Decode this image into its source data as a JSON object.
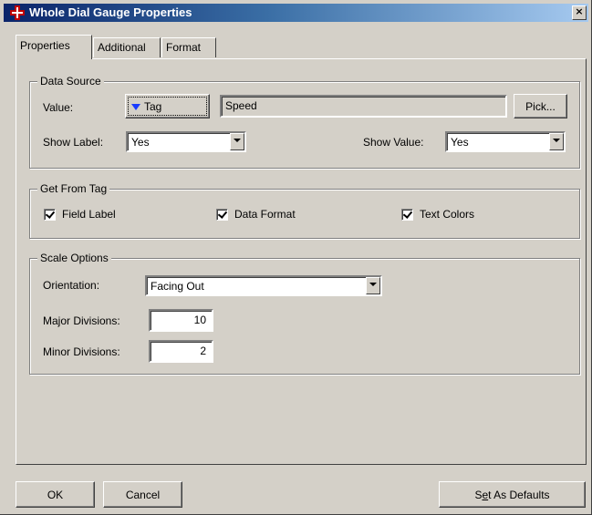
{
  "window": {
    "title": "Whole Dial Gauge Properties",
    "close_glyph": "×"
  },
  "tabs": [
    {
      "label": "Properties",
      "active": true
    },
    {
      "label": "Additional",
      "active": false
    },
    {
      "label": "Format",
      "active": false
    }
  ],
  "data_source": {
    "title": "Data Source",
    "value_label": "Value:",
    "tag_button": "Tag",
    "value_field": "Speed",
    "pick_button": "Pick...",
    "show_label_label": "Show Label:",
    "show_label_value": "Yes",
    "show_value_label": "Show Value:",
    "show_value_value": "Yes"
  },
  "get_from_tag": {
    "title": "Get From Tag",
    "field_label": {
      "label": "Field Label",
      "checked": true
    },
    "data_format": {
      "label": "Data Format",
      "checked": true
    },
    "text_colors": {
      "label": "Text Colors",
      "checked": true
    }
  },
  "scale_options": {
    "title": "Scale Options",
    "orientation_label": "Orientation:",
    "orientation_value": "Facing Out",
    "major_label": "Major Divisions:",
    "major_value": "10",
    "minor_label": "Minor Divisions:",
    "minor_value": "2"
  },
  "footer": {
    "ok": "OK",
    "cancel": "Cancel",
    "defaults_prefix": "S",
    "defaults_underlined": "e",
    "defaults_suffix": "t As Defaults"
  },
  "colors": {
    "titlebar_start": "#0a246a",
    "face": "#d4d0c8",
    "tag_arrow": "#1a3cff"
  },
  "icons": {
    "title_icon": "app-gear-icon",
    "close": "close-icon",
    "dropdown": "chevron-down-icon",
    "tag_arrow": "triangle-down-icon"
  }
}
